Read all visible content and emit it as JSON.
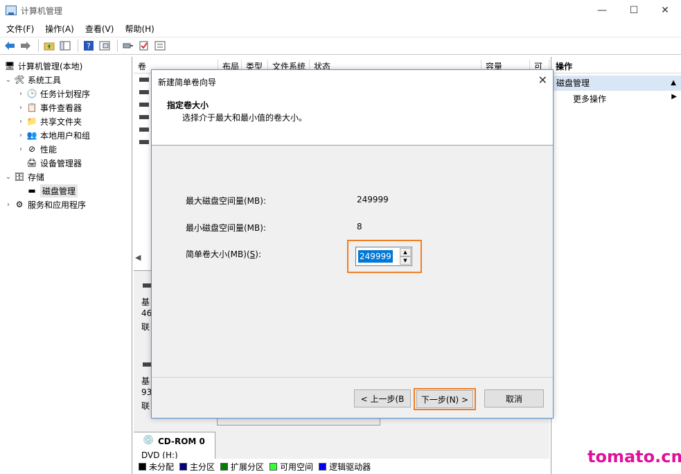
{
  "window": {
    "title": "计算机管理",
    "minimize_glyph": "—",
    "maximize_glyph": "☐",
    "close_glyph": "✕"
  },
  "menubar": [
    "文件(F)",
    "操作(A)",
    "查看(V)",
    "帮助(H)"
  ],
  "toolbar_icons": [
    "back-arrow-icon",
    "forward-arrow-icon",
    "folder-up-icon",
    "show-hide-tree-icon",
    "help-icon",
    "properties-icon",
    "connect-icon",
    "check-icon",
    "list-icon"
  ],
  "tree": {
    "root": "计算机管理(本地)",
    "system_tools": "系统工具",
    "task_scheduler": "任务计划程序",
    "event_viewer": "事件查看器",
    "shared_folders": "共享文件夹",
    "local_users": "本地用户和组",
    "performance": "性能",
    "device_manager": "设备管理器",
    "storage": "存储",
    "disk_management": "磁盘管理",
    "services": "服务和应用程序"
  },
  "columns": [
    "卷",
    "布局",
    "类型",
    "文件系统",
    "状态",
    "容量",
    "可"
  ],
  "disks": [
    {
      "line1": "基",
      "line2": "46",
      "line3": "联"
    },
    {
      "line1": "基",
      "line2": "93",
      "line3": "联"
    }
  ],
  "cdrom": {
    "name": "CD-ROM 0",
    "drive": "DVD (H:)"
  },
  "legend": [
    {
      "label": "未分配",
      "color": "#000000"
    },
    {
      "label": "主分区",
      "color": "#000080"
    },
    {
      "label": "扩展分区",
      "color": "#008000"
    },
    {
      "label": "可用空间",
      "color": "#33ff33"
    },
    {
      "label": "逻辑驱动器",
      "color": "#0000ff"
    }
  ],
  "actions": {
    "header": "操作",
    "section": "磁盘管理",
    "more": "更多操作"
  },
  "dialog": {
    "title": "新建简单卷向导",
    "heading": "指定卷大小",
    "subheading": "选择介于最大和最小值的卷大小。",
    "max_label": "最大磁盘空间量(MB):",
    "max_value": "249999",
    "min_label": "最小磁盘空间量(MB):",
    "min_value": "8",
    "size_label_prefix": "简单卷大小(MB)(",
    "size_label_key": "S",
    "size_label_suffix": "):",
    "size_value": "249999",
    "back_button": "< 上一步(B",
    "next_button": "下一步(N) >",
    "cancel_button": "取消"
  },
  "watermark": "tomato.cm",
  "accent_color": "#ef7d22"
}
